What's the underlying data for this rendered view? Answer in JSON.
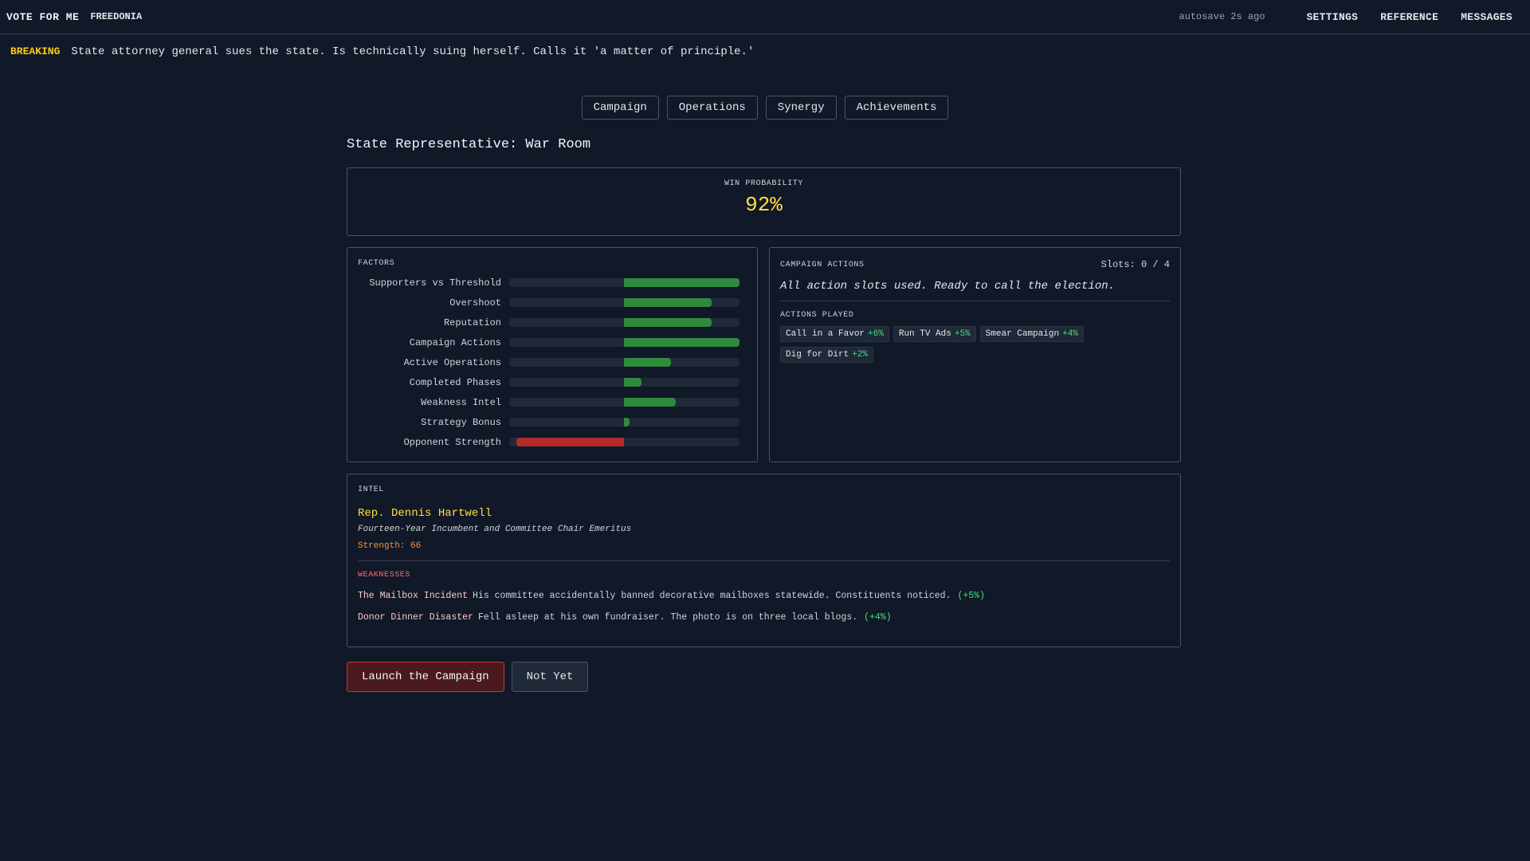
{
  "header": {
    "brand": "VOTE FOR ME",
    "region": "FREEDONIA",
    "autosave": "autosave 2s ago",
    "nav": [
      "SETTINGS",
      "REFERENCE",
      "MESSAGES"
    ]
  },
  "breaking": {
    "tag": "BREAKING",
    "text": "State attorney general sues the state. Is technically suing herself. Calls it 'a matter of principle.'"
  },
  "tabs": [
    "Campaign",
    "Operations",
    "Synergy",
    "Achievements"
  ],
  "page_title": "State Representative: War Room",
  "win": {
    "label": "WIN PROBABILITY",
    "value": "92%"
  },
  "factors": {
    "label": "FACTORS",
    "items": [
      {
        "label": "Supporters vs Threshold",
        "value": 1.0
      },
      {
        "label": "Overshoot",
        "value": 0.76
      },
      {
        "label": "Reputation",
        "value": 0.76
      },
      {
        "label": "Campaign Actions",
        "value": 1.0
      },
      {
        "label": "Active Operations",
        "value": 0.41
      },
      {
        "label": "Completed Phases",
        "value": 0.15
      },
      {
        "label": "Weakness Intel",
        "value": 0.45
      },
      {
        "label": "Strategy Bonus",
        "value": 0.05
      },
      {
        "label": "Opponent Strength",
        "value": -0.93
      }
    ],
    "colors": {
      "positive": "#2f8a3e",
      "negative": "#b52a2a"
    }
  },
  "actions": {
    "label": "CAMPAIGN ACTIONS",
    "slots": "Slots: 0 / 4",
    "message": "All action slots used. Ready to call the election.",
    "played_label": "ACTIONS PLAYED",
    "played": [
      {
        "name": "Call in a Favor",
        "bonus": "+6%"
      },
      {
        "name": "Run TV Ads",
        "bonus": "+5%"
      },
      {
        "name": "Smear Campaign",
        "bonus": "+4%"
      },
      {
        "name": "Dig for Dirt",
        "bonus": "+2%"
      }
    ]
  },
  "intel": {
    "label": "INTEL",
    "opponent_name": "Rep. Dennis Hartwell",
    "opponent_title": "Fourteen-Year Incumbent and Committee Chair Emeritus",
    "strength": "Strength: 66",
    "weaknesses_label": "WEAKNESSES",
    "weaknesses": [
      {
        "name": "The Mailbox Incident",
        "desc": "His committee accidentally banned decorative mailboxes statewide. Constituents noticed.",
        "bonus": "(+5%)"
      },
      {
        "name": "Donor Dinner Disaster",
        "desc": "Fell asleep at his own fundraiser. The photo is on three local blogs.",
        "bonus": "(+4%)"
      }
    ]
  },
  "buttons": {
    "launch": "Launch the Campaign",
    "not_yet": "Not Yet"
  }
}
